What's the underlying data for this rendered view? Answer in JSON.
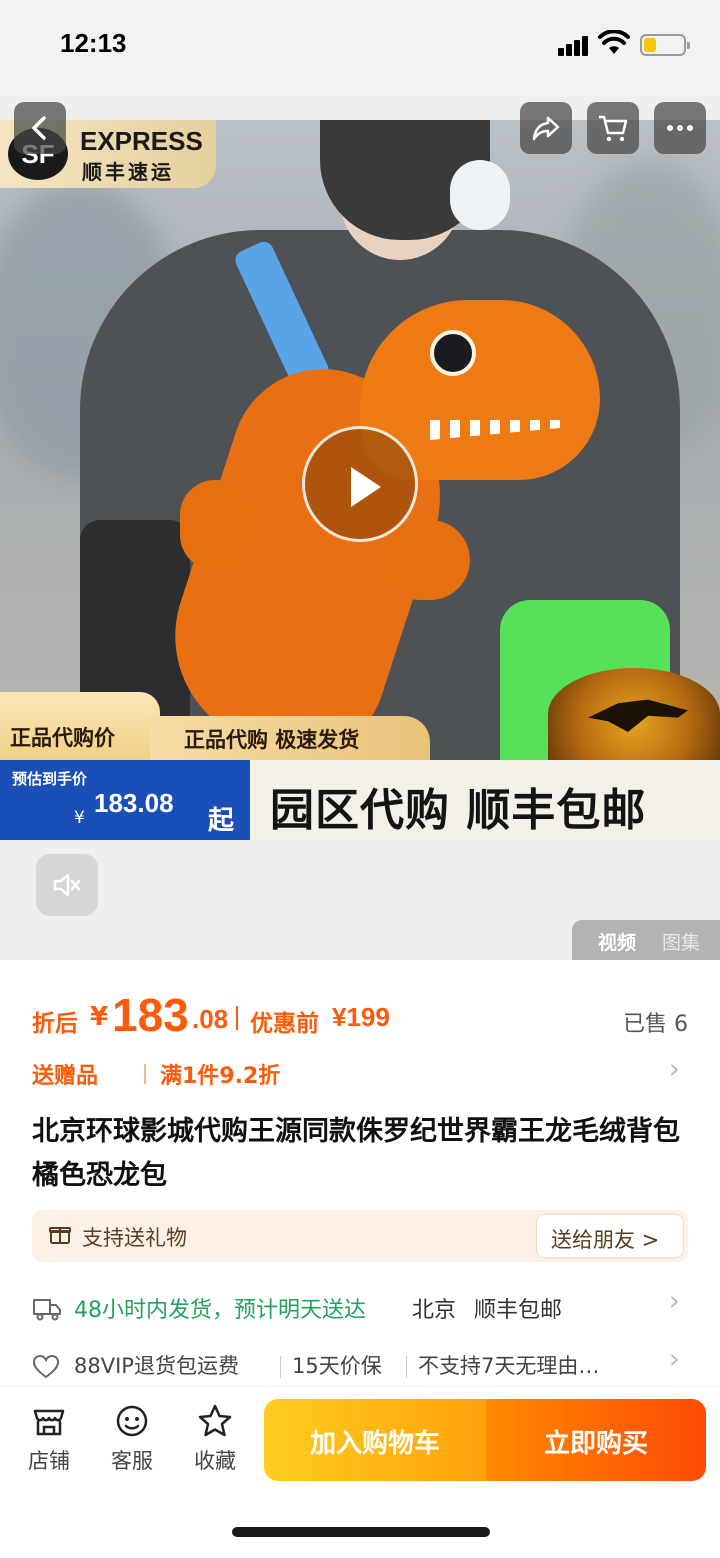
{
  "status_bar": {
    "time": "12:13",
    "icons": [
      "cellular-signal-icon",
      "wifi-icon",
      "battery-icon"
    ]
  },
  "nav": {
    "icons": [
      "back-icon",
      "share-icon",
      "cart-icon",
      "more-icon"
    ]
  },
  "media": {
    "sf_badge": {
      "logo": "SF",
      "en": "EXPRESS",
      "cn": "顺丰速运"
    },
    "banner": {
      "genuine_label": "正品代购价",
      "tag": "正品代购 极速发货",
      "est_label": "预估到手价",
      "est_currency": "¥",
      "est_price": "183.08",
      "est_suffix": "起",
      "slogan": "园区代购 顺丰包邮"
    },
    "tabs": {
      "video": "视频",
      "gallery": "图集"
    }
  },
  "product": {
    "price": {
      "label": "折后",
      "currency": "¥",
      "integer": "183",
      "decimal": ".08",
      "original_label": "优惠前",
      "original_value": "¥199"
    },
    "sold": "已售 6",
    "promo": {
      "gift": "送赠品",
      "discount": "满1件9.2折"
    },
    "title": "北京环球影城代购王源同款侏罗纪世界霸王龙毛绒背包橘色恐龙包",
    "gift_card": {
      "label": "支持送礼物",
      "button": "送给朋友 >"
    },
    "shipping": {
      "eta": "48小时内发货，预计明天送达",
      "city": "北京",
      "mail": "顺丰包邮"
    },
    "services": [
      "88VIP退货包运费",
      "15天价保",
      "不支持7天无理由…"
    ]
  },
  "bottom_bar": {
    "store": "店铺",
    "service": "客服",
    "favorite": "收藏",
    "add_to_cart": "加入购物车",
    "buy_now": "立即购买"
  },
  "colors": {
    "accent": "#ff5a0a",
    "green": "#22a25d",
    "cart": "#ffb80f",
    "buy": "#ff5a06"
  }
}
